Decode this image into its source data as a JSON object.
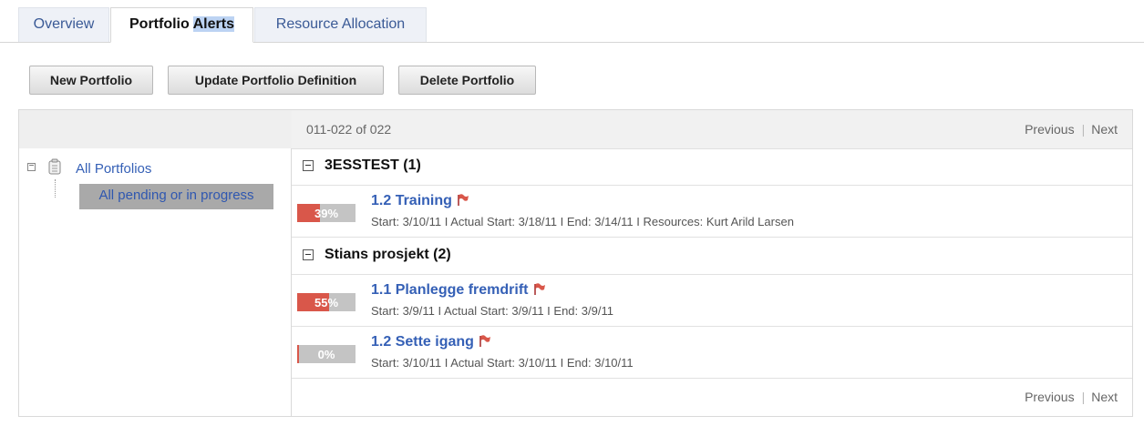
{
  "tabs": [
    {
      "label_pre": "Overview",
      "label_hl": ""
    },
    {
      "label_pre": "Portfolio ",
      "label_hl": "Alerts"
    },
    {
      "label_pre": "Resource Allocation",
      "label_hl": ""
    }
  ],
  "toolbar": {
    "new_label": "New Portfolio",
    "update_label": "Update Portfolio Definition",
    "delete_label": "Delete Portfolio"
  },
  "tree": {
    "root_label": "All Portfolios",
    "selected_label": "All pending or in progress"
  },
  "pager": {
    "range": "011-022 of 022",
    "previous": "Previous",
    "next": "Next",
    "separator": "|"
  },
  "colors": {
    "link": "#3560b6",
    "progress_fill": "#d9574a",
    "progress_track": "#c4c4c4",
    "flag": "#d9574a"
  },
  "groups": [
    {
      "title": "3ESSTEST (1)",
      "items": [
        {
          "title": "1.2 Training",
          "progress_percent": 39,
          "progress_label": "39%",
          "meta": "Start: 3/10/11 I Actual Start: 3/18/11 I End: 3/14/11 I Resources: Kurt Arild Larsen"
        }
      ]
    },
    {
      "title": "Stians prosjekt (2)",
      "items": [
        {
          "title": "1.1 Planlegge fremdrift",
          "progress_percent": 55,
          "progress_label": "55%",
          "meta": "Start: 3/9/11 I Actual Start: 3/9/11 I End: 3/9/11"
        },
        {
          "title": "1.2 Sette igang",
          "progress_percent": 3,
          "progress_label": "0%",
          "meta": "Start: 3/10/11 I Actual Start: 3/10/11 I End: 3/10/11"
        }
      ]
    }
  ]
}
